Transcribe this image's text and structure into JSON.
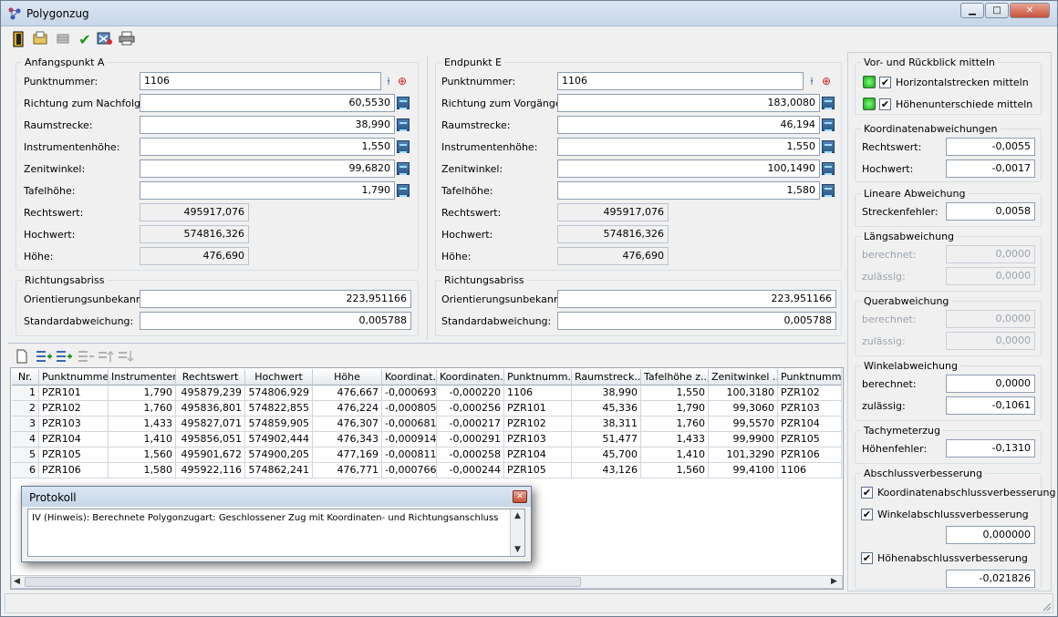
{
  "window": {
    "title": "Polygonzug",
    "minimize": "▁",
    "maximize": "□",
    "close": "✕"
  },
  "toolbar": {
    "icons": [
      "exit-icon",
      "open-icon",
      "table-icon",
      "check-icon",
      "map-icon",
      "print-icon"
    ]
  },
  "anfang": {
    "legend": "Anfangspunkt A",
    "punktnummer_label": "Punktnummer:",
    "punktnummer": "1106",
    "richtung_label": "Richtung zum Nachfolger:",
    "richtung": "60,5530",
    "raumstrecke_label": "Raumstrecke:",
    "raumstrecke": "38,990",
    "instrumentenhoehe_label": "Instrumentenhöhe:",
    "instrumentenhoehe": "1,550",
    "zenitwinkel_label": "Zenitwinkel:",
    "zenitwinkel": "99,6820",
    "tafelhoehe_label": "Tafelhöhe:",
    "tafelhoehe": "1,790",
    "rechtswert_label": "Rechtswert:",
    "rechtswert": "495917,076",
    "hochwert_label": "Hochwert:",
    "hochwert": "574816,326",
    "hoehe_label": "Höhe:",
    "hoehe": "476,690"
  },
  "anfang_abriss": {
    "legend": "Richtungsabriss",
    "orient_label": "Orientierungsunbekannte:",
    "orient": "223,951166",
    "std_label": "Standardabweichung:",
    "std": "0,005788"
  },
  "end": {
    "legend": "Endpunkt E",
    "punktnummer_label": "Punktnummer:",
    "punktnummer": "1106",
    "richtung_label": "Richtung zum Vorgänger:",
    "richtung": "183,0080",
    "raumstrecke_label": "Raumstrecke:",
    "raumstrecke": "46,194",
    "instrumentenhoehe_label": "Instrumentenhöhe:",
    "instrumentenhoehe": "1,550",
    "zenitwinkel_label": "Zenitwinkel:",
    "zenitwinkel": "100,1490",
    "tafelhoehe_label": "Tafelhöhe:",
    "tafelhoehe": "1,580",
    "rechtswert_label": "Rechtswert:",
    "rechtswert": "495917,076",
    "hochwert_label": "Hochwert:",
    "hochwert": "574816,326",
    "hoehe_label": "Höhe:",
    "hoehe": "476,690"
  },
  "end_abriss": {
    "legend": "Richtungsabriss",
    "orient_label": "Orientierungsunbekannte:",
    "orient": "223,951166",
    "std_label": "Standardabweichung:",
    "std": "0,005788"
  },
  "grid": {
    "headers": [
      "Nr.",
      "Punktnummer",
      "Instrumenten...",
      "Rechtswert",
      "Hochwert",
      "Höhe",
      "Koordinat...",
      "Koordinaten...",
      "Punktnumm...",
      "Raumstreck...",
      "Tafelhöhe z...",
      "Zenitwinkel ...",
      "Punktnumm..."
    ],
    "rows": [
      [
        "1",
        "PZR101",
        "1,790",
        "495879,239",
        "574806,929",
        "476,667",
        "-0,000693",
        "-0,000220",
        "1106",
        "38,990",
        "1,550",
        "100,3180",
        "PZR102"
      ],
      [
        "2",
        "PZR102",
        "1,760",
        "495836,801",
        "574822,855",
        "476,224",
        "-0,000805",
        "-0,000256",
        "PZR101",
        "45,336",
        "1,790",
        "99,3060",
        "PZR103"
      ],
      [
        "3",
        "PZR103",
        "1,433",
        "495827,071",
        "574859,905",
        "476,307",
        "-0,000681",
        "-0,000217",
        "PZR102",
        "38,311",
        "1,760",
        "99,5570",
        "PZR104"
      ],
      [
        "4",
        "PZR104",
        "1,410",
        "495856,051",
        "574902,444",
        "476,343",
        "-0,000914",
        "-0,000291",
        "PZR103",
        "51,477",
        "1,433",
        "99,9900",
        "PZR105"
      ],
      [
        "5",
        "PZR105",
        "1,560",
        "495901,672",
        "574900,205",
        "477,169",
        "-0,000811",
        "-0,000258",
        "PZR104",
        "45,700",
        "1,410",
        "101,3290",
        "PZR106"
      ],
      [
        "6",
        "PZR106",
        "1,580",
        "495922,116",
        "574862,241",
        "476,771",
        "-0,000766",
        "-0,000244",
        "PZR105",
        "43,126",
        "1,560",
        "99,4100",
        "1106"
      ]
    ]
  },
  "protokoll": {
    "title": "Protokoll",
    "text": "IV (Hinweis): Berechnete Polygonzugart: Geschlossener Zug mit Koordinaten- und Richtungsanschluss"
  },
  "right": {
    "vor": {
      "legend": "Vor- und Rückblick mitteln",
      "horiz": "Horizontalstrecken mitteln",
      "hoehen": "Höhenunterschiede mitteln"
    },
    "koord": {
      "legend": "Koordinatenabweichungen",
      "rechts_label": "Rechtswert:",
      "rechts": "-0,0055",
      "hoch_label": "Hochwert:",
      "hoch": "-0,0017"
    },
    "linear": {
      "legend": "Lineare Abweichung",
      "strecken_label": "Streckenfehler:",
      "strecken": "0,0058"
    },
    "laengs": {
      "legend": "Längsabweichung",
      "ber_label": "berechnet:",
      "ber": "0,0000",
      "zul_label": "zulässig:",
      "zul": "0,0000"
    },
    "quer": {
      "legend": "Querabweichung",
      "ber_label": "berechnet:",
      "ber": "0,0000",
      "zul_label": "zulässig:",
      "zul": "0,0000"
    },
    "winkel": {
      "legend": "Winkelabweichung",
      "ber_label": "berechnet:",
      "ber": "0,0000",
      "zul_label": "zulässig:",
      "zul": "-0,1061"
    },
    "tachy": {
      "legend": "Tachymeterzug",
      "hoehen_label": "Höhenfehler:",
      "hoehen": "-0,1310"
    },
    "abschluss": {
      "legend": "Abschlussverbesserung",
      "koord": "Koordinatenabschlussverbesserung",
      "winkel": "Winkelabschlussverbesserung",
      "winkel_val": "0,000000",
      "hoehen": "Höhenabschlussverbesserung",
      "hoehen_val": "-0,021826"
    }
  },
  "check": "✔"
}
